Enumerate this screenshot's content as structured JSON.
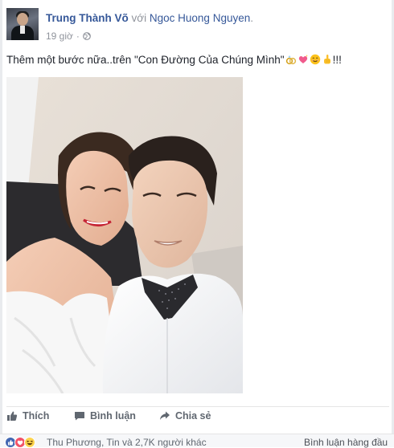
{
  "post": {
    "author": "Trung Thành Võ",
    "with_word": "với",
    "tagged": "Ngoc Huong Nguyen",
    "period": ".",
    "time": "19 giờ",
    "separator": "·",
    "privacy_icon": "globe-icon",
    "status_text": "Thêm một bước nữa..trên \"Con Đường Của Chúng Mình\"",
    "status_suffix": "!!!",
    "emojis": [
      "wedding-rings-emoji",
      "sparkling-heart-emoji",
      "smiling-face-emoji",
      "pointing-hand-emoji"
    ],
    "photo": "selfie-couple-photo"
  },
  "actions": {
    "like": "Thích",
    "comment": "Bình luận",
    "share": "Chia sẻ"
  },
  "reactions": {
    "icons": [
      "like-reaction-icon",
      "love-reaction-icon",
      "haha-reaction-icon"
    ],
    "summary": "Thu Phương, Tin và 2,7K người khác",
    "sort_label": "Bình luận hàng đầu"
  },
  "colors": {
    "link": "#365899",
    "meta": "#90949c",
    "action": "#606770",
    "like_blue": "#4267b2",
    "love_red": "#f25268",
    "haha_yellow": "#fcd34d"
  }
}
